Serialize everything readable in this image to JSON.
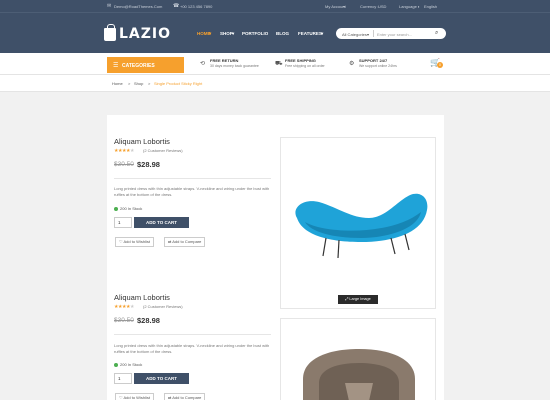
{
  "topbar": {
    "email": "Demo@RoadThemes.Com",
    "phone": "+00 123 456 7890",
    "account": "My Account",
    "currency_label": "Currency :",
    "currency_value": "USD",
    "language_label": "Language :",
    "language_value": "English"
  },
  "logo": {
    "name": "LAZIO"
  },
  "nav": {
    "items": [
      {
        "label": "HOME",
        "active": true
      },
      {
        "label": "SHOP"
      },
      {
        "label": "PORTFOLIO"
      },
      {
        "label": "BLOG"
      },
      {
        "label": "FEATURES"
      }
    ]
  },
  "search": {
    "category": "All Categories",
    "placeholder": "Enter your search..."
  },
  "categories_button": {
    "label": "CATEGORIES"
  },
  "features": [
    {
      "title": "FREE RETURN",
      "subtitle": "30 days money back guarantee"
    },
    {
      "title": "FREE SHIPPING",
      "subtitle": "Free shipping on all order"
    },
    {
      "title": "SUPPORT 24/7",
      "subtitle": "We support online 24hrs"
    }
  ],
  "cart": {
    "count": "0"
  },
  "breadcrumb": {
    "items": [
      "Home",
      "Shop",
      "Single Product Sticky Right"
    ]
  },
  "products": [
    {
      "title": "Aliquam Lobortis",
      "reviews": "(2 Customer Reviews)",
      "old_price": "$30.50",
      "price": "$28.98",
      "description": "Long printed dress with thin adjustable straps. V-neckline and wiring under the bust with ruffles at the bottom of the dress.",
      "stock": "200 In Stock",
      "qty": "1",
      "add_to_cart": "ADD TO CART",
      "wishlist": "Add to Wishlist",
      "compare": "Add to Compare",
      "rating": 4
    },
    {
      "title": "Aliquam Lobortis",
      "reviews": "(2 Customer Reviews)",
      "old_price": "$30.50",
      "price": "$28.98",
      "description": "Long printed dress with thin adjustable straps. V-neckline and wiring under the bust with ruffles at the bottom of the dress.",
      "stock": "200 In Stock",
      "qty": "1",
      "add_to_cart": "ADD TO CART",
      "wishlist": "Add to Wishlist",
      "compare": "Add to Compare",
      "rating": 4
    }
  ],
  "large_image_button": {
    "label": "Large Image"
  },
  "colors": {
    "header": "#3f5068",
    "accent": "#f6a02d",
    "chair_blue": "#1fa3d8",
    "chair_brown": "#8a7a6c"
  }
}
